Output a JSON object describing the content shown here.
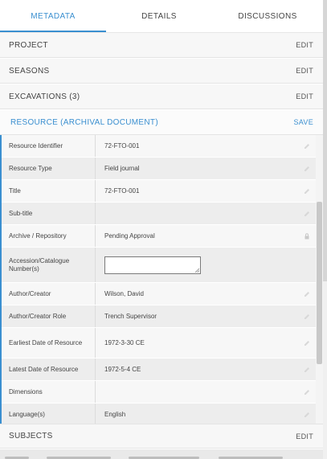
{
  "tabs": [
    {
      "label": "METADATA"
    },
    {
      "label": "DETAILS"
    },
    {
      "label": "DISCUSSIONS"
    }
  ],
  "sections": {
    "project": {
      "title": "PROJECT",
      "action": "EDIT"
    },
    "seasons": {
      "title": "SEASONS",
      "action": "EDIT"
    },
    "excavations": {
      "title": "EXCAVATIONS (3)",
      "action": "EDIT"
    },
    "subjects": {
      "title": "SUBJECTS",
      "action": "EDIT"
    }
  },
  "resource": {
    "title": "RESOURCE (ARCHIVAL DOCUMENT)",
    "action": "SAVE",
    "fields": [
      {
        "label": "Resource Identifier",
        "value": "72-FTO-001",
        "icon": "edit-icon"
      },
      {
        "label": "Resource Type",
        "value": "Field journal",
        "icon": "edit-icon"
      },
      {
        "label": "Title",
        "value": "72-FTO-001",
        "icon": "edit-icon"
      },
      {
        "label": "Sub-title",
        "value": "",
        "icon": "edit-icon"
      },
      {
        "label": "Archive / Repository",
        "value": "Pending Approval",
        "icon": "lock-icon"
      },
      {
        "label": "Accession/Catalogue Number(s)",
        "value": "",
        "icon": "text-input"
      },
      {
        "label": "Author/Creator",
        "value": "Wilson, David",
        "icon": "edit-icon"
      },
      {
        "label": "Author/Creator Role",
        "value": "Trench Supervisor",
        "icon": "edit-icon"
      },
      {
        "label": "Earliest Date of Resource",
        "value": "1972-3-30 CE",
        "icon": "edit-icon"
      },
      {
        "label": "Latest Date of Resource",
        "value": "1972-5-4 CE",
        "icon": "edit-icon"
      },
      {
        "label": "Dimensions",
        "value": "",
        "icon": "edit-icon"
      },
      {
        "label": "Language(s)",
        "value": "English",
        "icon": "edit-icon"
      }
    ]
  },
  "colors": {
    "accent": "#3a8fd0"
  }
}
